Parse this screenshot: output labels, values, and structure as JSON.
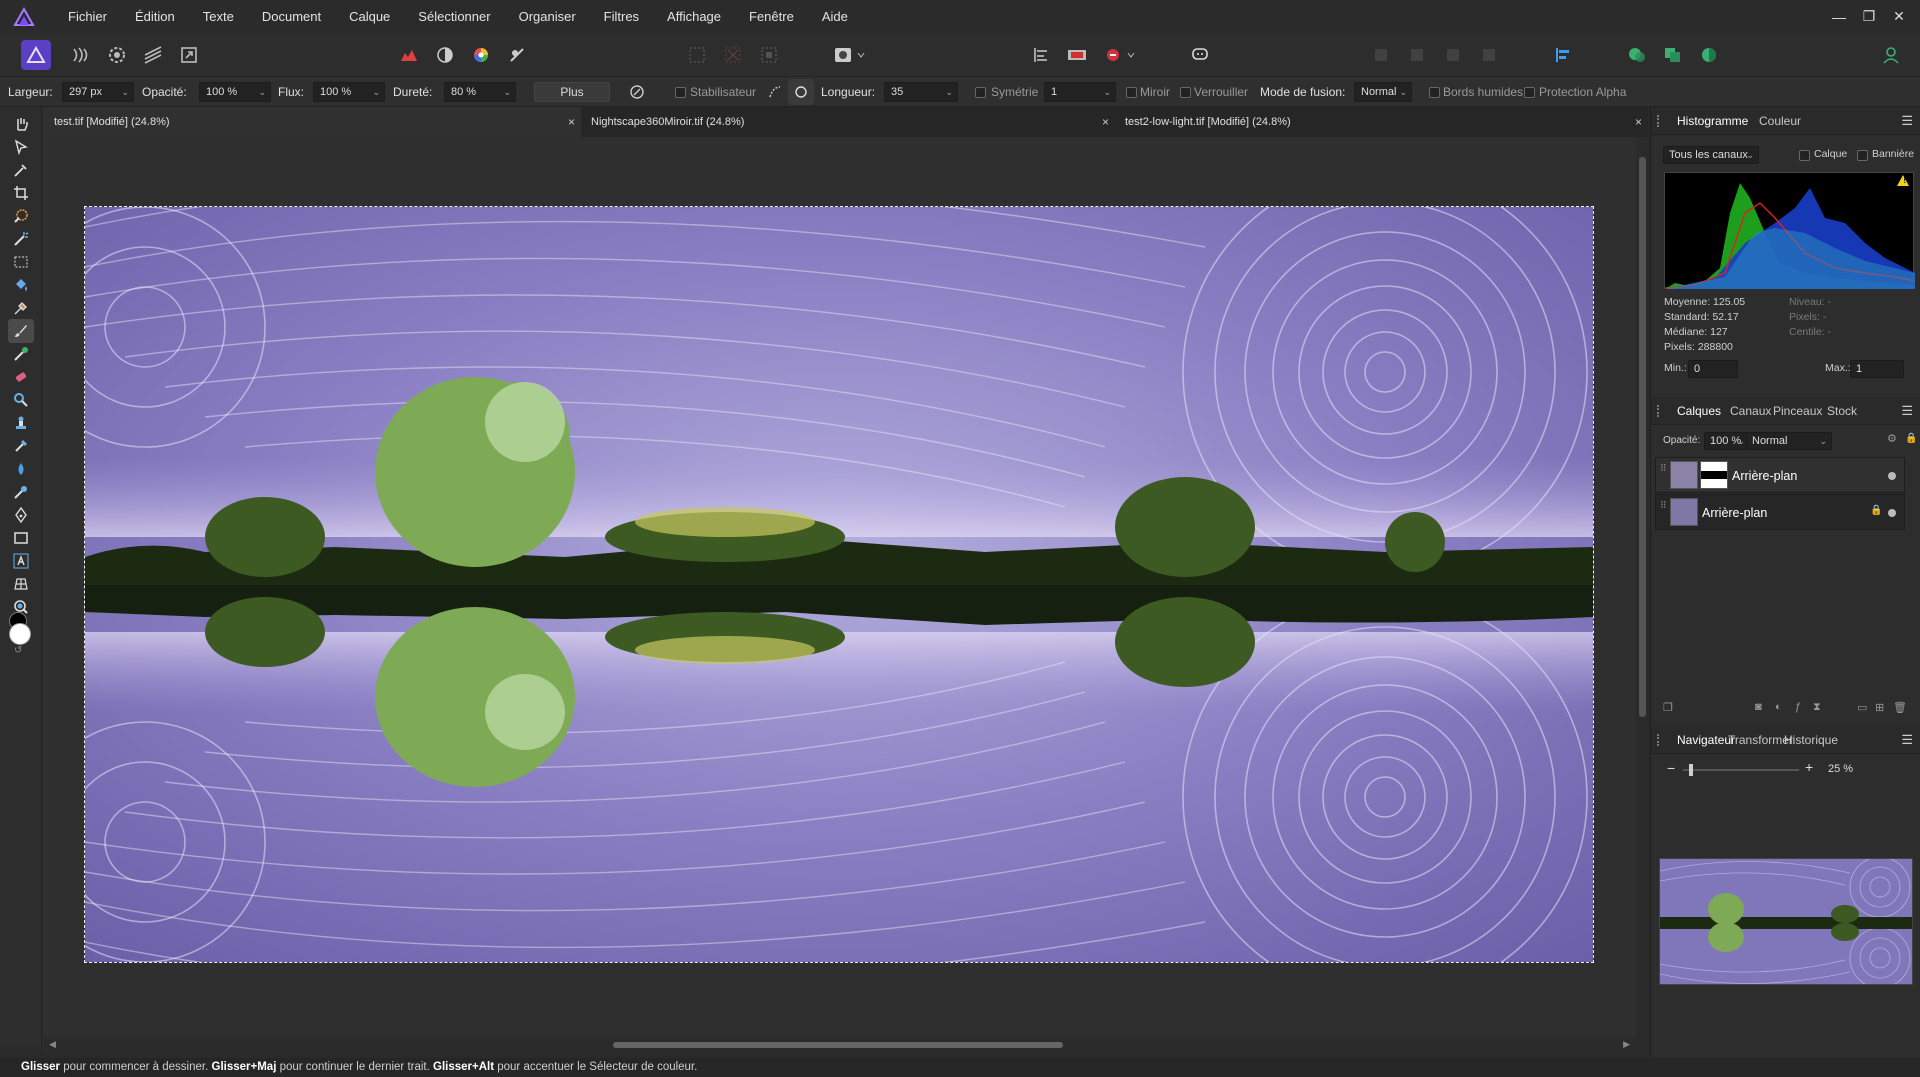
{
  "menu": [
    "Fichier",
    "Édition",
    "Texte",
    "Document",
    "Calque",
    "Sélectionner",
    "Organiser",
    "Filtres",
    "Affichage",
    "Fenêtre",
    "Aide"
  ],
  "window_controls": [
    "—",
    "❐",
    "✕"
  ],
  "context": {
    "width_label": "Largeur:",
    "width_value": "297 px",
    "opacity_label": "Opacité:",
    "opacity_value": "100 %",
    "flow_label": "Flux:",
    "flow_value": "100 %",
    "hardness_label": "Dureté:",
    "hardness_value": "80 %",
    "more_button": "Plus",
    "stabilizer": "Stabilisateur",
    "length_label": "Longueur:",
    "length_value": "35",
    "symmetry": "Symétrie",
    "symmetry_value": "1",
    "mirror": "Miroir",
    "lock": "Verrouiller",
    "blend_label": "Mode de fusion:",
    "blend_value": "Normal",
    "wet_edges": "Bords humides",
    "protect_alpha": "Protection Alpha"
  },
  "tabs": [
    {
      "label": "test.tif [Modifié] (24.8%)",
      "close": "×"
    },
    {
      "label": "Nightscape360Miroir.tif (24.8%)",
      "close": "×"
    },
    {
      "label": "test2-low-light.tif [Modifié] (24.8%)",
      "close": "×"
    }
  ],
  "histogram": {
    "tabs": [
      "Histogramme",
      "Couleur"
    ],
    "channel": "Tous les canaux",
    "layer_check": "Calque",
    "banner_check": "Bannière",
    "stats_left": [
      "Moyenne: 125.05",
      "Standard: 52.17",
      "Médiane: 127",
      "Pixels: 288800"
    ],
    "stats_right": [
      "Niveau: -",
      "Pixels: -",
      "Centile: -"
    ],
    "min_label": "Min.:",
    "min_value": "0",
    "max_label": "Max.:",
    "max_value": "1",
    "warning": "!"
  },
  "layers": {
    "tabs": [
      "Calques",
      "Canaux",
      "Pinceaux",
      "Stock"
    ],
    "opacity_label": "Opacité:",
    "opacity_value": "100 %",
    "blend_value": "Normal",
    "items": [
      {
        "name": "Arrière-plan"
      },
      {
        "name": "Arrière-plan"
      }
    ]
  },
  "navigator": {
    "tabs": [
      "Navigateur",
      "Transformer",
      "Historique"
    ],
    "zoom_value": "25 %",
    "zoom_minus": "−",
    "zoom_plus": "+",
    "zoom_level": 0.05
  },
  "status": {
    "k1": "Glisser",
    "t1": " pour commencer à dessiner. ",
    "k2": "Glisser+Maj",
    "t2": " pour continuer le dernier trait. ",
    "k3": "Glisser+Alt",
    "t3": " pour accentuer le Sélecteur de couleur."
  },
  "colors": {
    "accent": "#6b4fd1",
    "sky": "#7f73b8",
    "panel": "#2d2d2d"
  }
}
